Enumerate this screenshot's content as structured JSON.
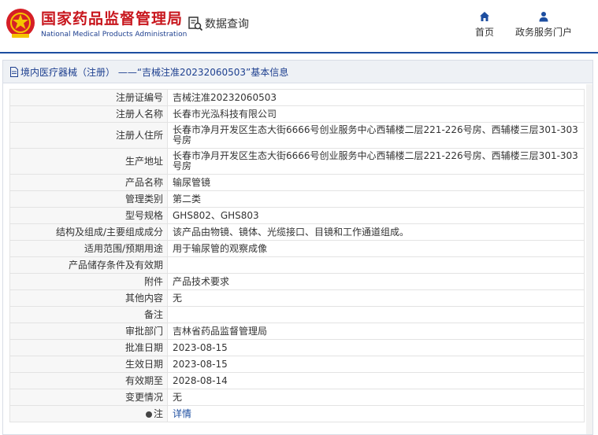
{
  "header": {
    "brand_cn": "国家药品监督管理局",
    "brand_en": "National Medical Products Administration",
    "query_label": "数据查询",
    "nav": [
      {
        "label": "首页",
        "icon": "home-icon"
      },
      {
        "label": "政务服务门户",
        "icon": "user-icon"
      }
    ],
    "colors": {
      "brand_red": "#c8161d",
      "brand_blue": "#1d3f8f",
      "accent": "#1d4ea0"
    }
  },
  "panel": {
    "title": "境内医疗器械（注册） ——“吉械注准20232060503”基本信息",
    "rows": [
      {
        "label": "注册证编号",
        "value": "吉械注准20232060503"
      },
      {
        "label": "注册人名称",
        "value": "长春市光泓科技有限公司"
      },
      {
        "label": "注册人住所",
        "value": "长春市净月开发区生态大街6666号创业服务中心西辅楼二层221-226号房、西辅楼三层301-303号房"
      },
      {
        "label": "生产地址",
        "value": "长春市净月开发区生态大街6666号创业服务中心西辅楼二层221-226号房、西辅楼三层301-303号房"
      },
      {
        "label": "产品名称",
        "value": "输尿管镜"
      },
      {
        "label": "管理类别",
        "value": "第二类"
      },
      {
        "label": "型号规格",
        "value": "GHS802、GHS803"
      },
      {
        "label": "结构及组成/主要组成成分",
        "value": "该产品由物镜、镜体、光缆接口、目镜和工作通道组成。"
      },
      {
        "label": "适用范围/预期用途",
        "value": "用于输尿管的观察成像"
      },
      {
        "label": "产品储存条件及有效期",
        "value": ""
      },
      {
        "label": "附件",
        "value": "产品技术要求"
      },
      {
        "label": "其他内容",
        "value": "无"
      },
      {
        "label": "备注",
        "value": ""
      },
      {
        "label": "审批部门",
        "value": "吉林省药品监督管理局"
      },
      {
        "label": "批准日期",
        "value": "2023-08-15"
      },
      {
        "label": "生效日期",
        "value": "2023-08-15"
      },
      {
        "label": "有效期至",
        "value": "2028-08-14"
      },
      {
        "label": "变更情况",
        "value": "无"
      }
    ],
    "note": {
      "label": "注",
      "link": "详情"
    }
  }
}
